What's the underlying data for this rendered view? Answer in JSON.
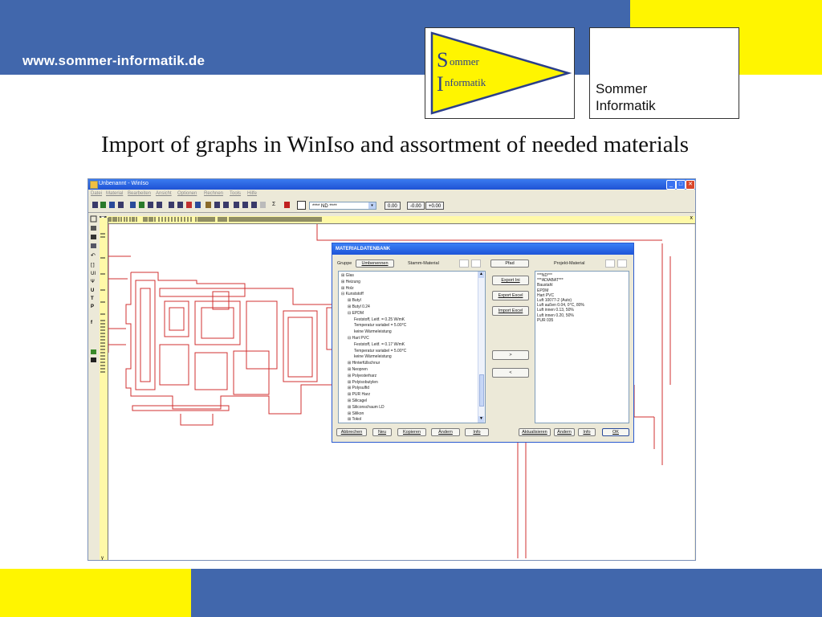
{
  "slide": {
    "url": "www.sommer-informatik.de",
    "logo_text": [
      "Sommer",
      "Informatik"
    ],
    "logo_pennant_text": [
      "Sommer",
      "Informatik"
    ],
    "title": "Import of graphs in WinIso and assortment of needed materials",
    "colors": {
      "blue": "#4167ac",
      "yellow": "#fff500"
    }
  },
  "app": {
    "window_title": "Unbenannt - WinIso",
    "menu": [
      "Datei",
      "Material",
      "Bearbeiten",
      "Ansicht",
      "Optionen",
      "Rechnen",
      "Tools",
      "Hilfe"
    ],
    "toolbar": {
      "combo_value": "**** ND ****",
      "num1": "0.00",
      "num2": "-0.00",
      "num3": "+0.00"
    },
    "ruler_v_label": "y",
    "ruler_h_label": "x",
    "left_tools": [
      "U",
      "T",
      "P",
      "f"
    ],
    "dialog": {
      "title": "MATERIALDATENBANK",
      "gruppe_label": "Gruppe",
      "rename_button": "Umbenennen",
      "stamm_label": "Stamm-Material",
      "pfad_button": "Pfad",
      "projekt_label": "Projekt-Material",
      "tree": [
        {
          "t": "⊞ Glas",
          "indent": 0
        },
        {
          "t": "⊞ Heizung",
          "indent": 0
        },
        {
          "t": "⊞ Holz",
          "indent": 0
        },
        {
          "t": "⊟ Kunststoff",
          "indent": 0
        },
        {
          "t": "⊞ Butyl",
          "indent": 1
        },
        {
          "t": "⊞ Butyl 0.24",
          "indent": 1
        },
        {
          "t": "⊟ EPDM",
          "indent": 1
        },
        {
          "t": "Feststoff, Leitf. = 0.25 W/mK",
          "indent": 2
        },
        {
          "t": "Temperatur variabel = 5.00°C",
          "indent": 2
        },
        {
          "t": "keine Wärmeleistung",
          "indent": 2
        },
        {
          "t": "⊟ Hart PVC",
          "indent": 1
        },
        {
          "t": "Feststoff, Leitf. = 0.17 W/mK",
          "indent": 2
        },
        {
          "t": "Temperatur variabel = 5.00°C",
          "indent": 2
        },
        {
          "t": "keine Wärmeleistung",
          "indent": 2
        },
        {
          "t": "⊞ Hinterfüllschnur",
          "indent": 1
        },
        {
          "t": "⊞ Neopren",
          "indent": 1
        },
        {
          "t": "⊞ Polyesterharz",
          "indent": 1
        },
        {
          "t": "⊞ Polyisobutylen",
          "indent": 1
        },
        {
          "t": "⊞ Polysulfid",
          "indent": 1
        },
        {
          "t": "⊞ PUR Harz",
          "indent": 1
        },
        {
          "t": "⊞ Silicagel",
          "indent": 1
        },
        {
          "t": "⊞ Siliconschaum LD",
          "indent": 1
        },
        {
          "t": "⊞ Silikon",
          "indent": 1
        },
        {
          "t": "⊞ Tokol",
          "indent": 1
        }
      ],
      "mid_buttons": [
        "Export Ini",
        "Export Excel",
        "Import Excel"
      ],
      "arrow_right": ">",
      "arrow_left": "<",
      "project_items": [
        "***ND***",
        "***ADIABAT***",
        "Baustahl",
        "EPDM",
        "Hart PVC",
        "Luft 10077-2 (Auto)",
        "Luft außen 0.04, 0°C, 80%",
        "Luft innen 0.13, 50%",
        "Luft innen 0.20, 50%",
        "PUR 035"
      ],
      "bottom_buttons": [
        "Abbrechen",
        "Neu",
        "Kopieren",
        "Ändern",
        "Info"
      ],
      "bottom_right_buttons": [
        "Aktualisieren",
        "Ändern",
        "Info",
        "OK"
      ]
    }
  }
}
